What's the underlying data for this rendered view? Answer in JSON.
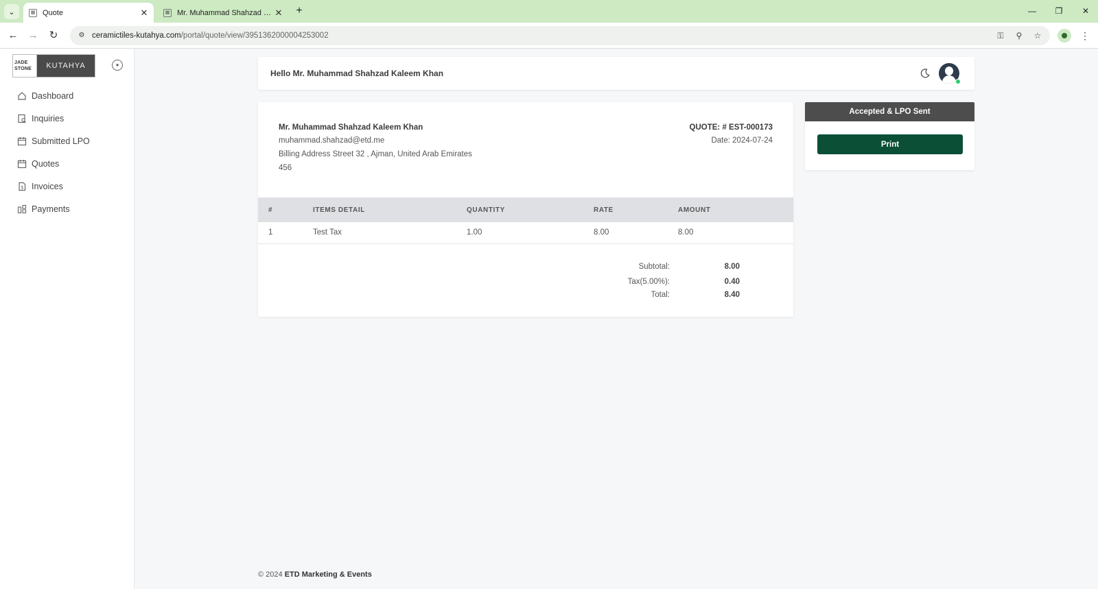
{
  "browser": {
    "tabs": [
      {
        "label": "Quote",
        "active": true
      },
      {
        "label": "Mr. Muhammad Shahzad Kaleem Khan",
        "active": false
      }
    ],
    "url_host": "ceramictiles-kutahya.com",
    "url_path": "/portal/quote/view/3951362000004253002"
  },
  "sidebar": {
    "logo": {
      "left": "JADE STONE",
      "right": "KUTAHYA"
    },
    "items": [
      {
        "label": "Dashboard",
        "icon": "home-icon"
      },
      {
        "label": "Inquiries",
        "icon": "inquiry-icon"
      },
      {
        "label": "Submitted LPO",
        "icon": "calendar-icon"
      },
      {
        "label": "Quotes",
        "icon": "calendar-icon"
      },
      {
        "label": "Invoices",
        "icon": "invoice-icon"
      },
      {
        "label": "Payments",
        "icon": "payments-icon"
      }
    ]
  },
  "header": {
    "greeting": "Hello Mr. Muhammad Shahzad Kaleem Khan"
  },
  "quote": {
    "customer_name": "Mr. Muhammad Shahzad Kaleem Khan",
    "email": "muhammad.shahzad@etd.me",
    "address": "Billing Address Street 32 , Ajman, United Arab Emirates",
    "zip": "456",
    "number": "QUOTE: # EST-000173",
    "date": "Date: 2024-07-24",
    "columns": [
      "#",
      "ITEMS DETAIL",
      "QUANTITY",
      "RATE",
      "AMOUNT"
    ],
    "items": [
      {
        "n": "1",
        "detail": "Test Tax",
        "quantity": "1.00",
        "rate": "8.00",
        "amount": "8.00"
      }
    ],
    "totals": {
      "subtotal_label": "Subtotal:",
      "subtotal": "8.00",
      "tax_label": "Tax(5.00%):",
      "tax": "0.40",
      "total_label": "Total:",
      "total": "8.40"
    }
  },
  "status": {
    "label": "Accepted & LPO Sent",
    "print_label": "Print",
    "accent": "#0b4f36"
  },
  "footer": {
    "prefix": "© 2024",
    "company": "ETD Marketing & Events"
  }
}
